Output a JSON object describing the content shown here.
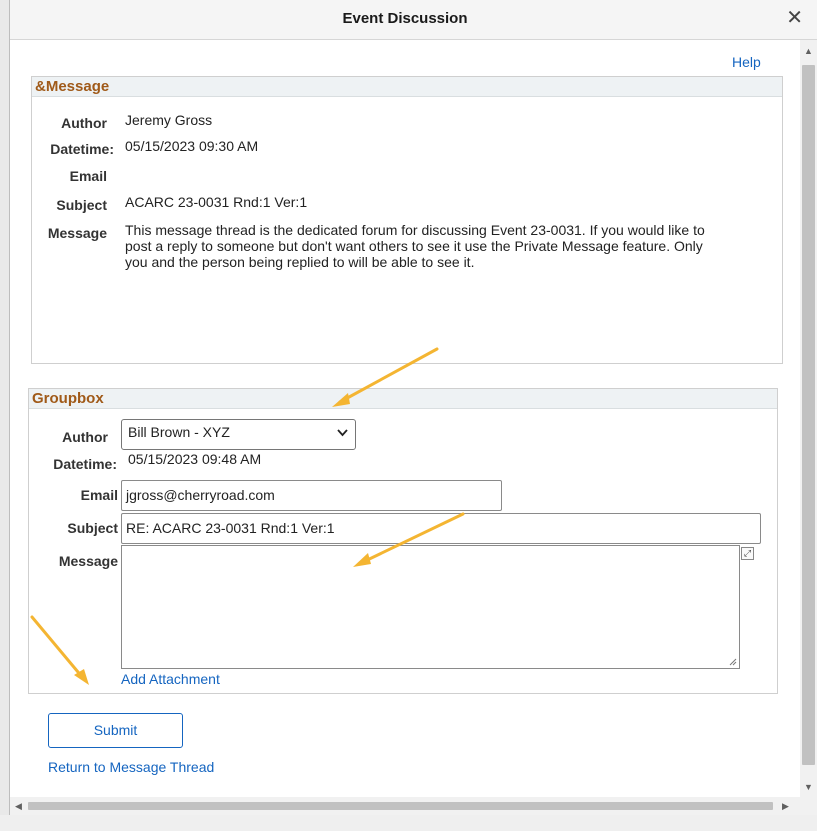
{
  "dialog": {
    "title": "Event Discussion",
    "help_label": "Help"
  },
  "message_group": {
    "header": "&Message",
    "author_label": "Author",
    "author_value": "Jeremy Gross",
    "datetime_label": "Datetime:",
    "datetime_value": "05/15/2023 09:30 AM",
    "email_label": "Email",
    "subject_label": "Subject",
    "subject_value": "ACARC 23-0031 Rnd:1 Ver:1",
    "message_label": "Message",
    "message_lines": [
      "This message thread is the dedicated forum for discussing Event 23-0031.  If you would like to",
      "post a reply to someone but don't want others to see it use the Private Message feature.  Only",
      "you and the person being replied to will be able to see it."
    ]
  },
  "reply_group": {
    "header": "Groupbox",
    "author_label": "Author",
    "author_selected": "Bill Brown - XYZ",
    "datetime_label": "Datetime:",
    "datetime_value": "05/15/2023 09:48 AM",
    "email_label": "Email",
    "email_value": "jgross@cherryroad.com",
    "subject_label": "Subject",
    "subject_value": "RE: ACARC 23-0031 Rnd:1 Ver:1",
    "message_label": "Message",
    "message_value": "",
    "add_attachment_label": "Add Attachment"
  },
  "actions": {
    "submit_label": "Submit",
    "return_label": "Return to Message Thread"
  },
  "colors": {
    "header_text": "#a05a19",
    "link": "#1565c0",
    "annotation_arrow": "#f4b532"
  },
  "icons": {
    "close": "close-icon",
    "dropdown": "chevron-down-icon",
    "expand": "expand-icon"
  }
}
